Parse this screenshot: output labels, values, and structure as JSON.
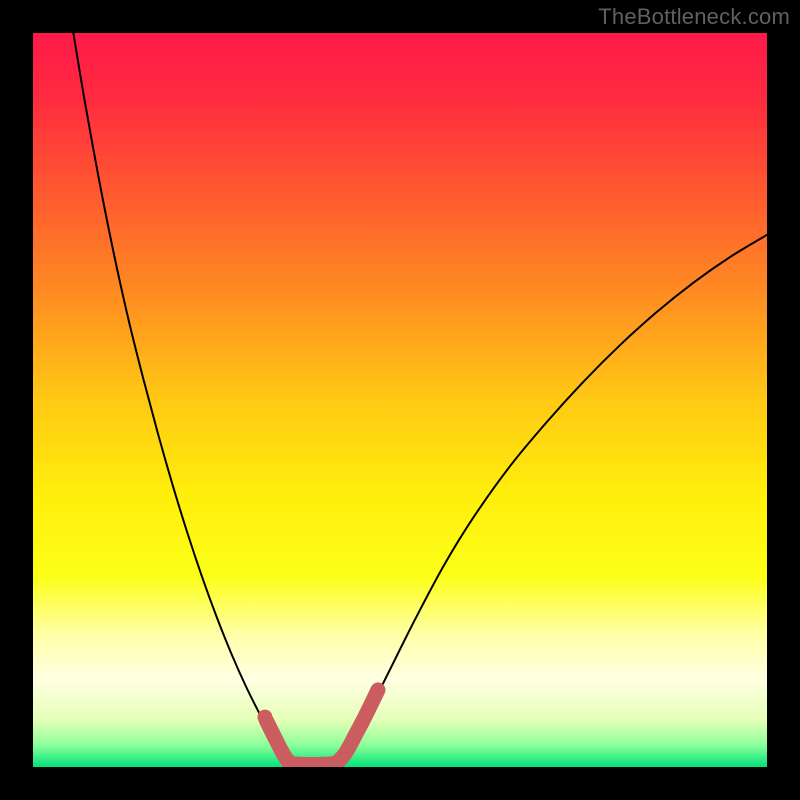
{
  "watermark": "TheBottleneck.com",
  "chart_data": {
    "type": "line",
    "title": "",
    "xlabel": "",
    "ylabel": "",
    "xlim": [
      0,
      100
    ],
    "ylim": [
      0,
      100
    ],
    "gradient_stops": [
      {
        "offset": 0.0,
        "color": "#ff1a49"
      },
      {
        "offset": 0.09,
        "color": "#ff2b3f"
      },
      {
        "offset": 0.22,
        "color": "#ff5a30"
      },
      {
        "offset": 0.35,
        "color": "#ff8a22"
      },
      {
        "offset": 0.5,
        "color": "#ffc914"
      },
      {
        "offset": 0.63,
        "color": "#ffef0b"
      },
      {
        "offset": 0.74,
        "color": "#fcff18"
      },
      {
        "offset": 0.82,
        "color": "#ffffa8"
      },
      {
        "offset": 0.88,
        "color": "#ffffe2"
      },
      {
        "offset": 0.935,
        "color": "#e6ffb8"
      },
      {
        "offset": 0.97,
        "color": "#8dff9a"
      },
      {
        "offset": 1.0,
        "color": "#00e47a"
      }
    ],
    "series": [
      {
        "name": "left-curve",
        "x": [
          5.5,
          7,
          9,
          11,
          13,
          15,
          17,
          19,
          21,
          23,
          25,
          27,
          29,
          31,
          32.5,
          34,
          35.2
        ],
        "y": [
          100,
          91,
          80,
          70,
          61,
          53,
          45.5,
          38.5,
          32,
          26,
          20.5,
          15.5,
          11,
          7,
          4.2,
          2,
          0.4
        ]
      },
      {
        "name": "right-curve",
        "x": [
          41.5,
          43,
          45,
          48,
          52,
          56,
          60,
          65,
          70,
          75,
          80,
          85,
          90,
          95,
          100
        ],
        "y": [
          0.4,
          2.2,
          6,
          12,
          20,
          27.5,
          34,
          41,
          47,
          52.5,
          57.5,
          62,
          66,
          69.5,
          72.5
        ]
      }
    ],
    "marker_segments": [
      {
        "name": "left-marker",
        "x": [
          31.8,
          33.2,
          34.2,
          35.0
        ],
        "y": [
          6.3,
          3.5,
          1.6,
          0.5
        ]
      },
      {
        "name": "bottom-marker",
        "x": [
          35.0,
          37.0,
          39.0,
          41.3
        ],
        "y": [
          0.45,
          0.35,
          0.35,
          0.45
        ]
      },
      {
        "name": "right-marker",
        "x": [
          41.3,
          42.5,
          44.0,
          45.6,
          47.0
        ],
        "y": [
          0.5,
          1.8,
          4.5,
          7.6,
          10.5
        ]
      }
    ],
    "dot": {
      "x": 31.6,
      "y": 6.8
    },
    "marker_color": "#cb5d60",
    "curve_color": "#000000"
  }
}
